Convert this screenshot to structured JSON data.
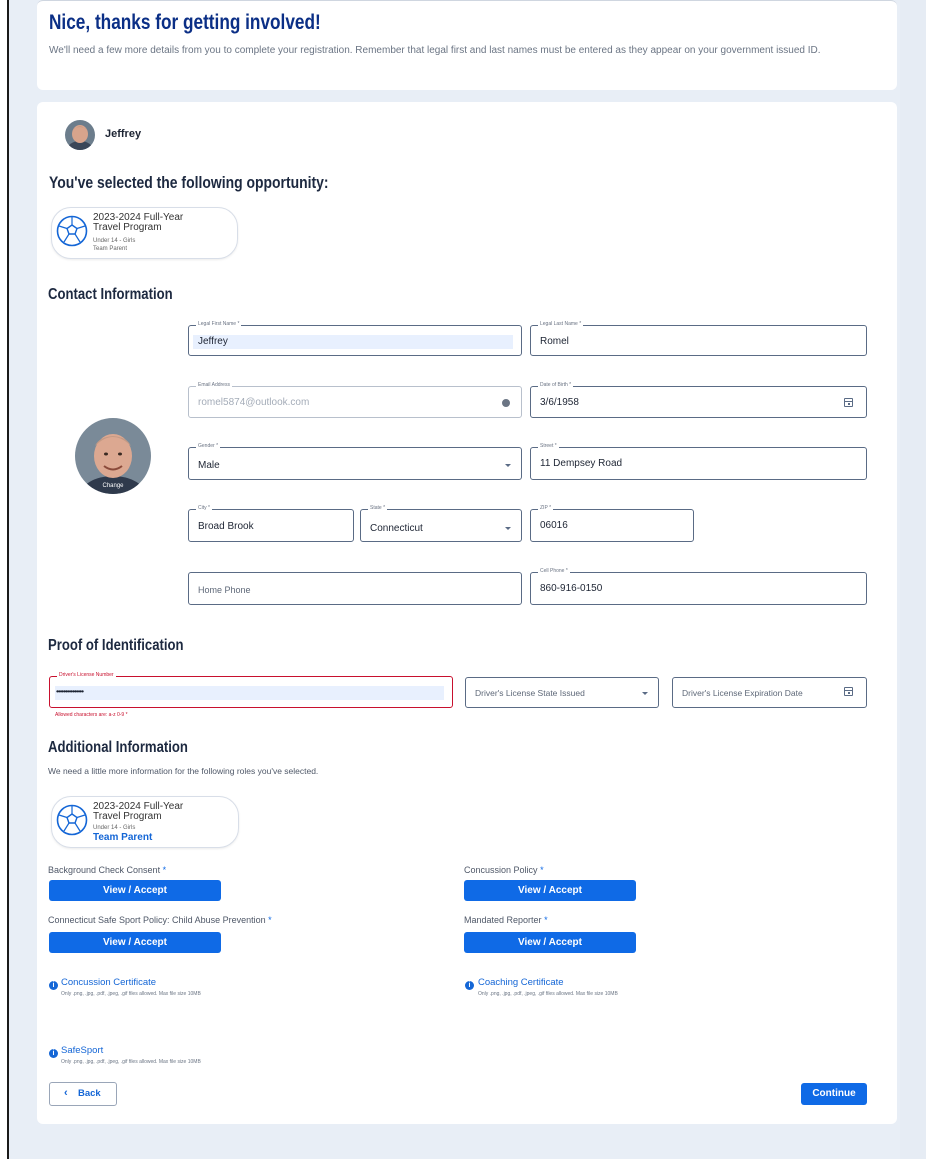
{
  "header": {
    "title": "Nice, thanks for getting involved!",
    "subtitle": "We'll need a few more details from you to complete your registration. Remember that legal first and last names must be entered as they appear on your government issued ID."
  },
  "user": {
    "name": "Jeffrey"
  },
  "selection": {
    "heading": "You've selected the following opportunity:",
    "program": "2023-2024 Full-Year Travel Program",
    "division": "Under 14 - Girls",
    "role": "Team Parent"
  },
  "contact": {
    "heading": "Contact Information",
    "photo_action": "Change",
    "first_name": {
      "label": "Legal First Name *",
      "value": "Jeffrey"
    },
    "last_name": {
      "label": "Legal Last Name *",
      "value": "Romel"
    },
    "email": {
      "label": "Email Address",
      "value": "romel5874@outlook.com"
    },
    "dob": {
      "label": "Date of Birth *",
      "value": "3/6/1958"
    },
    "gender": {
      "label": "Gender *",
      "value": "Male"
    },
    "street": {
      "label": "Street *",
      "value": "11 Dempsey Road"
    },
    "city": {
      "label": "City *",
      "value": "Broad Brook"
    },
    "state": {
      "label": "State *",
      "value": "Connecticut"
    },
    "zip": {
      "label": "ZIP *",
      "value": "06016"
    },
    "home_phone": {
      "placeholder": "Home Phone"
    },
    "cell_phone": {
      "label": "Cell Phone *",
      "value": "860-916-0150"
    }
  },
  "identification": {
    "heading": "Proof of Identification",
    "license_number": {
      "label": "Driver's License Number",
      "value": "•••••••••••••••",
      "error": "Allowed characters are: a-z 0-9 *"
    },
    "license_state": {
      "placeholder": "Driver's License State Issued"
    },
    "license_expiration": {
      "placeholder": "Driver's License Expiration Date"
    }
  },
  "additional": {
    "heading": "Additional Information",
    "subtitle": "We need a little more information for the following roles you've selected.",
    "program": "2023-2024 Full-Year Travel Program",
    "division": "Under 14 - Girls",
    "role": "Team Parent",
    "requirements": [
      {
        "label": "Background Check Consent",
        "required": "*",
        "button": "View / Accept"
      },
      {
        "label": "Concussion Policy",
        "required": "*",
        "button": "View / Accept"
      },
      {
        "label": "Connecticut Safe Sport Policy: Child Abuse Prevention",
        "required": "*",
        "button": "View / Accept"
      },
      {
        "label": "Mandated Reporter",
        "required": "*",
        "button": "View / Accept"
      }
    ],
    "uploads": [
      {
        "title": "Concussion Certificate",
        "note": "Only .png, .jpg, .pdf, .jpeg, .gif files allowed.   Max file size 10MB"
      },
      {
        "title": "Coaching Certificate",
        "note": "Only .png, .jpg, .pdf, .jpeg, .gif files allowed.   Max file size 10MB"
      },
      {
        "title": "SafeSport",
        "note": "Only .png, .jpg, .pdf, .jpeg, .gif files allowed.   Max file size 10MB"
      }
    ]
  },
  "footer": {
    "back_label": "Back",
    "continue_label": "Continue"
  },
  "colors": {
    "brand_navy": "#0b2f86",
    "primary_blue": "#0f6ae6",
    "error_red": "#c8102e",
    "page_bg": "#e8eef6"
  },
  "icons": {
    "ball": "soccer-ball-icon",
    "calendar": "calendar-icon",
    "dropdown": "chevron-down-icon",
    "info": "info-icon",
    "back": "chevron-left-icon"
  }
}
